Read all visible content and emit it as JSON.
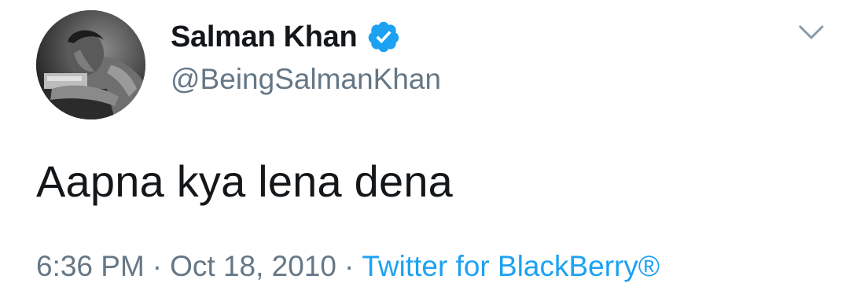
{
  "tweet": {
    "author": {
      "display_name": "Salman Khan",
      "handle": "@BeingSalmanKhan",
      "verified": true,
      "verified_icon": "verified-badge-icon",
      "avatar": "profile-photo"
    },
    "menu_icon": "chevron-down-icon",
    "text": "Aapna kya lena dena",
    "time": "6:36 PM",
    "separator": "·",
    "date": "Oct 18, 2010",
    "source": "Twitter for BlackBerry®"
  },
  "colors": {
    "primary_text": "#14171a",
    "secondary_text": "#657786",
    "link": "#1da1f2",
    "verified": "#1da1f2"
  }
}
